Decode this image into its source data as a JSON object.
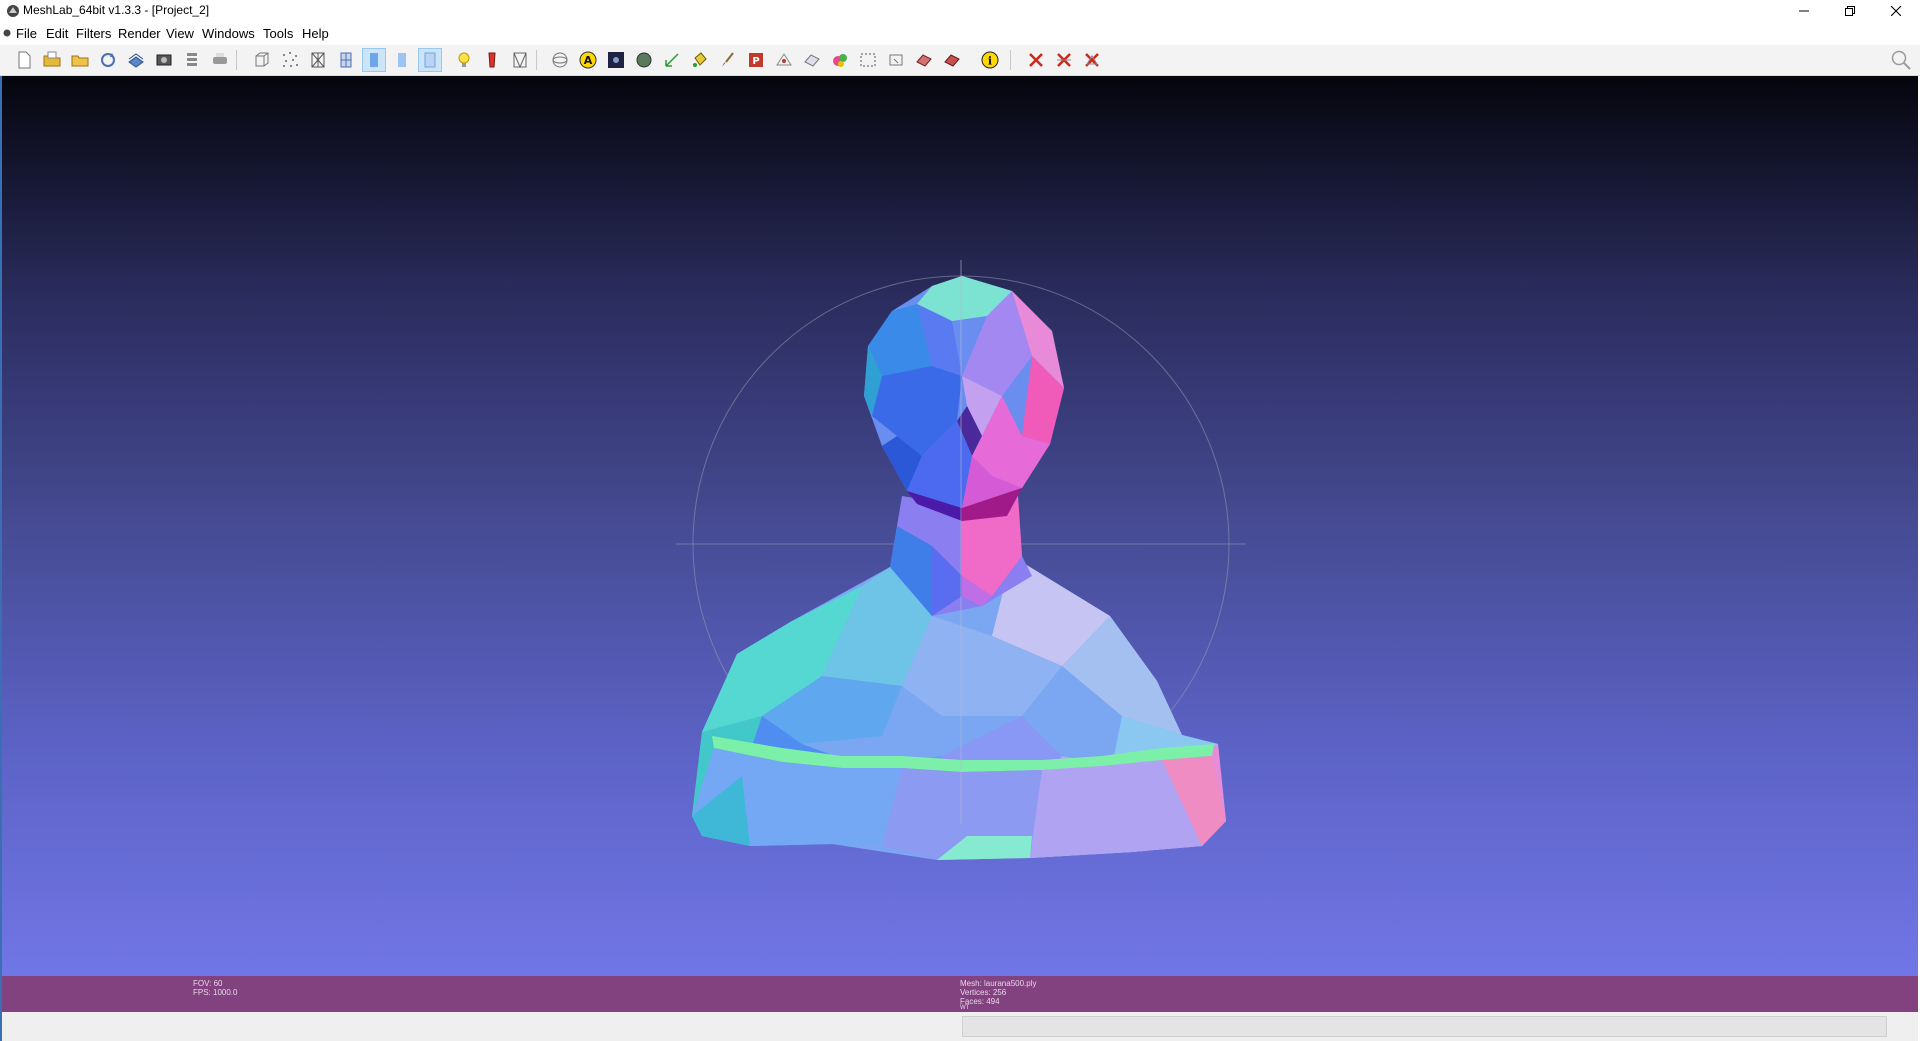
{
  "window": {
    "title": "MeshLab_64bit v1.3.3 - [Project_2]",
    "controls": [
      "minimize",
      "restore",
      "close"
    ]
  },
  "menu": {
    "items": [
      {
        "label": "File"
      },
      {
        "label": "Edit"
      },
      {
        "label": "Filters"
      },
      {
        "label": "Render"
      },
      {
        "label": "View"
      },
      {
        "label": "Windows"
      },
      {
        "label": "Tools"
      },
      {
        "label": "Help"
      }
    ],
    "mdi_controls": "– ▫ ×"
  },
  "toolbar": {
    "buttons": [
      {
        "name": "new-document-icon"
      },
      {
        "name": "open-project-icon"
      },
      {
        "name": "import-mesh-icon"
      },
      {
        "name": "reload-icon"
      },
      {
        "name": "save-snapshot-icon"
      },
      {
        "name": "snapshot-camera-icon"
      },
      {
        "name": "layers-icon"
      },
      {
        "name": "print-icon"
      },
      {
        "name": "bounding-box-icon"
      },
      {
        "name": "points-icon"
      },
      {
        "name": "wireframe-icon"
      },
      {
        "name": "hidden-lines-icon"
      },
      {
        "name": "flat-shading-icon"
      },
      {
        "name": "smooth-shading-icon"
      },
      {
        "name": "texture-icon"
      },
      {
        "name": "light-bulb-icon"
      },
      {
        "name": "color-icon"
      },
      {
        "name": "back-face-icon"
      },
      {
        "name": "manipulator-icon"
      },
      {
        "name": "annotation-icon"
      },
      {
        "name": "raster-icon"
      },
      {
        "name": "sphere-icon"
      },
      {
        "name": "measure-icon"
      },
      {
        "name": "paint-bucket-icon"
      },
      {
        "name": "brush-icon"
      },
      {
        "name": "pickpoint-icon"
      },
      {
        "name": "select-faces-icon"
      },
      {
        "name": "select-vertices-icon"
      },
      {
        "name": "color-paint-icon"
      },
      {
        "name": "select-region-icon"
      },
      {
        "name": "reference-icon"
      },
      {
        "name": "align-icon"
      },
      {
        "name": "mutual-info-icon"
      },
      {
        "name": "info-icon"
      },
      {
        "name": "delete-faces-icon"
      },
      {
        "name": "delete-vertices-icon"
      },
      {
        "name": "delete-selected-icon"
      }
    ],
    "accent": "#cce4f7"
  },
  "info": {
    "fov": "FOV: 60",
    "fps": "FPS:  1000.0",
    "mesh": "Mesh: laurana500.ply",
    "vertices": "Vertices: 256",
    "faces": "Faces: 494",
    "wt": "WT"
  },
  "colors": {
    "info_panel": "#82427f",
    "viewport_top": "#05050d",
    "viewport_bottom": "#7176e6"
  }
}
